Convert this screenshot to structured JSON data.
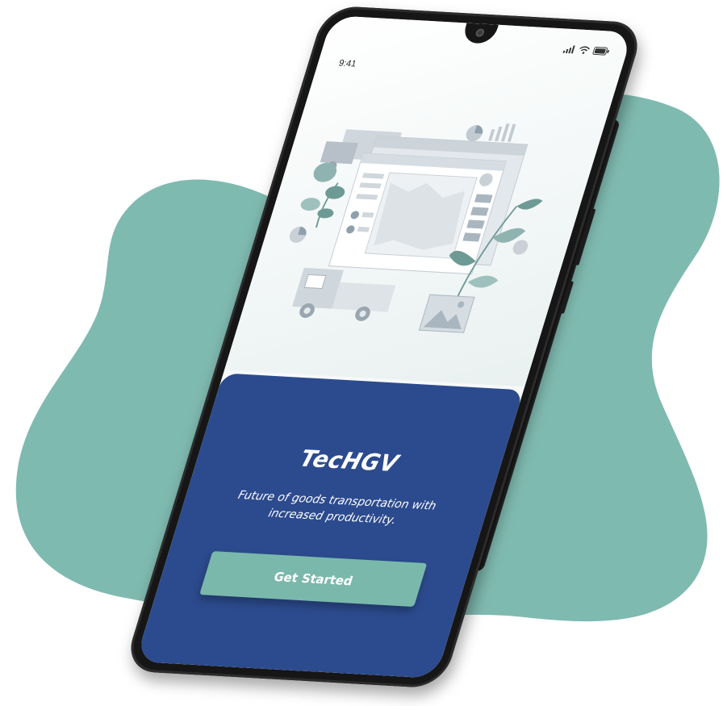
{
  "status_bar": {
    "time": "9:41"
  },
  "app": {
    "brand_name": "TecHGV",
    "tagline": "Future of goods transportation with increased productivity.",
    "cta_label": "Get Started"
  },
  "illustration": {
    "subject": "logistics dashboard with truck, map screen, charts and plants"
  },
  "colors": {
    "background_blob": "#7fbab0",
    "panel": "#2c4b8e",
    "cta": "#7ab8ab",
    "phone_frame": "#161616"
  },
  "icons": {
    "signal": "signal-icon",
    "wifi": "wifi-icon",
    "battery": "battery-icon",
    "front_camera": "camera-icon"
  }
}
